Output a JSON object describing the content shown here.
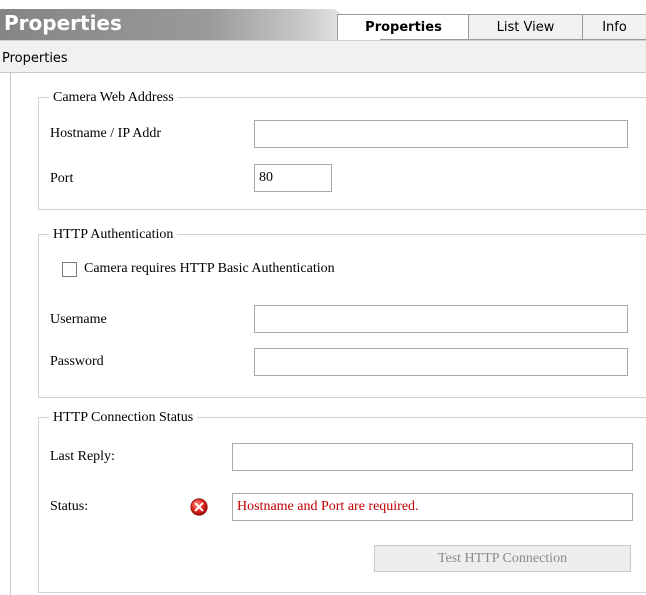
{
  "window": {
    "title": "Properties",
    "tabs": [
      {
        "label": "Properties",
        "active": true
      },
      {
        "label": "List View",
        "active": false
      },
      {
        "label": "Info",
        "active": false
      }
    ]
  },
  "toolbar": {
    "label": "Properties"
  },
  "camera_web_address": {
    "legend": "Camera Web Address",
    "hostname_label": "Hostname / IP Addr",
    "hostname_value": "",
    "port_label": "Port",
    "port_value": "80"
  },
  "http_authentication": {
    "legend": "HTTP Authentication",
    "checkbox_label": "Camera requires HTTP Basic Authentication",
    "checkbox_checked": false,
    "username_label": "Username",
    "username_value": "",
    "password_label": "Password",
    "password_value": ""
  },
  "http_connection_status": {
    "legend": "HTTP Connection Status",
    "last_reply_label": "Last Reply:",
    "last_reply_value": "",
    "status_label": "Status:",
    "status_value": "Hostname and Port are required.",
    "status_icon": "error-icon",
    "test_button_label": "Test HTTP Connection"
  },
  "colors": {
    "error_text": "#c00000",
    "error_icon": "#e02020",
    "disabled_text": "#8a8a8a"
  }
}
